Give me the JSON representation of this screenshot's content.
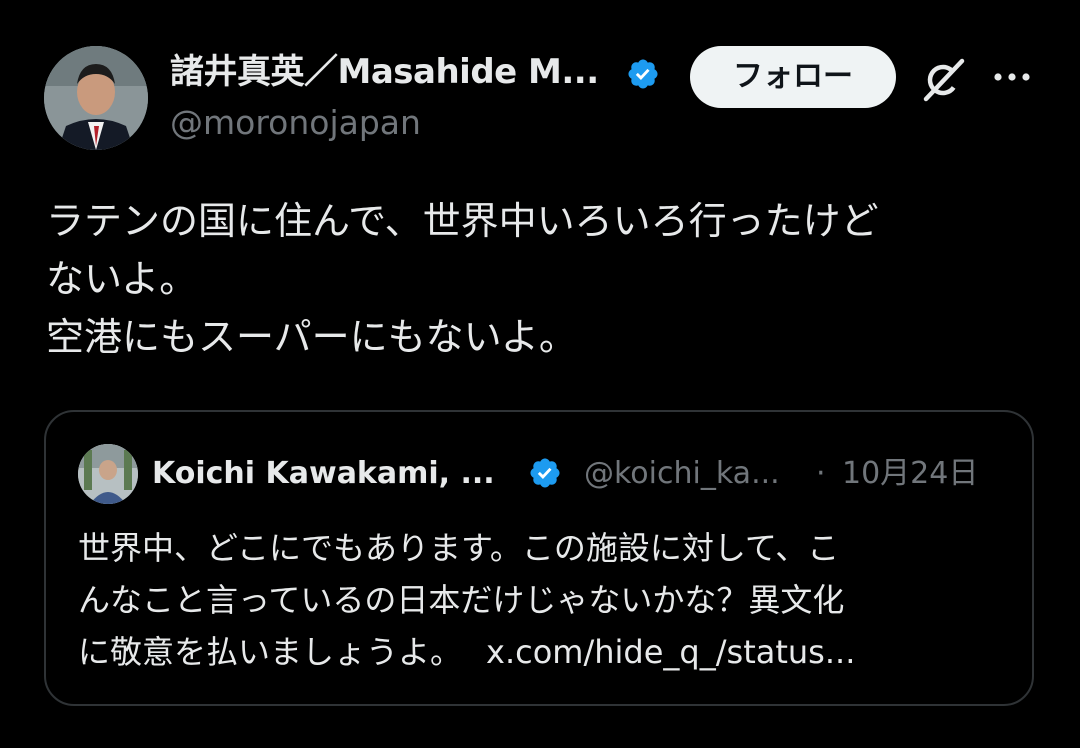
{
  "post": {
    "author_name": "諸井真英／Masahide M...",
    "author_handle": "@moronojapan",
    "follow_label": "フォロー",
    "text_lines": [
      "ラテンの国に住んで、世界中いろいろ行ったけど",
      "ないよ。",
      "空港にもスーパーにもないよ。"
    ]
  },
  "quote": {
    "author_name": "Koichi Kawakami, ...",
    "author_handle": "@koichi_ka...",
    "separator": "·",
    "date": "10月24日",
    "text_lines": [
      "世界中、どこにでもあります。この施設に対して、こ",
      "んなこと言っているの日本だけじゃないかな？異文化",
      "に敬意を払いましょうよ。"
    ],
    "link": "x.com/hide_q_/status..."
  },
  "icons": {
    "verified": "verified-badge-icon",
    "grok": "grok-icon",
    "more": "more-options-icon"
  },
  "colors": {
    "background": "#000000",
    "text": "#e7e9ea",
    "muted": "#71767b",
    "verified": "#1d9bf0",
    "border": "#2f3336",
    "follow_bg": "#eff3f4"
  }
}
